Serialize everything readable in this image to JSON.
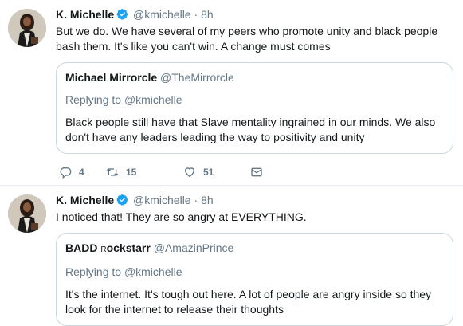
{
  "tweets": [
    {
      "author": {
        "name": "K. Michelle",
        "handle": "@kmichelle"
      },
      "separator": "·",
      "time": "8h",
      "text": "But we do. We have several of my peers who promote unity and black people bash them. It's like you can't win. A change must comes",
      "quote": {
        "name": "Michael Mirrorcle",
        "handle": "@TheMirrorcle",
        "replying_label": "Replying to",
        "replying_to": "@kmichelle",
        "text": "Black people still have that Slave mentality ingrained in our minds. We also don't have any leaders leading the way to positivity and unity"
      },
      "actions": {
        "replies": "4",
        "retweets": "15",
        "likes": "51"
      }
    },
    {
      "author": {
        "name": "K. Michelle",
        "handle": "@kmichelle"
      },
      "separator": "·",
      "time": "8h",
      "text": "I noticed that! They are so angry at EVERYTHING.",
      "quote": {
        "name_prefix": "BADD ",
        "name_small": "R",
        "name_suffix": "ockstarr",
        "handle": "@AmazinPrince",
        "replying_label": "Replying to",
        "replying_to": "@kmichelle",
        "text": "It's the internet. It's tough out here. A lot of people are angry inside so they look for the internet to release their thoughts"
      }
    }
  ],
  "colors": {
    "verified": "#1da1f2",
    "secondary_text": "#657786",
    "border": "#ccd6dd"
  },
  "icons": {
    "reply": "reply-icon",
    "retweet": "retweet-icon",
    "like": "heart-icon",
    "dm": "envelope-icon",
    "verified": "verified-badge-icon"
  }
}
